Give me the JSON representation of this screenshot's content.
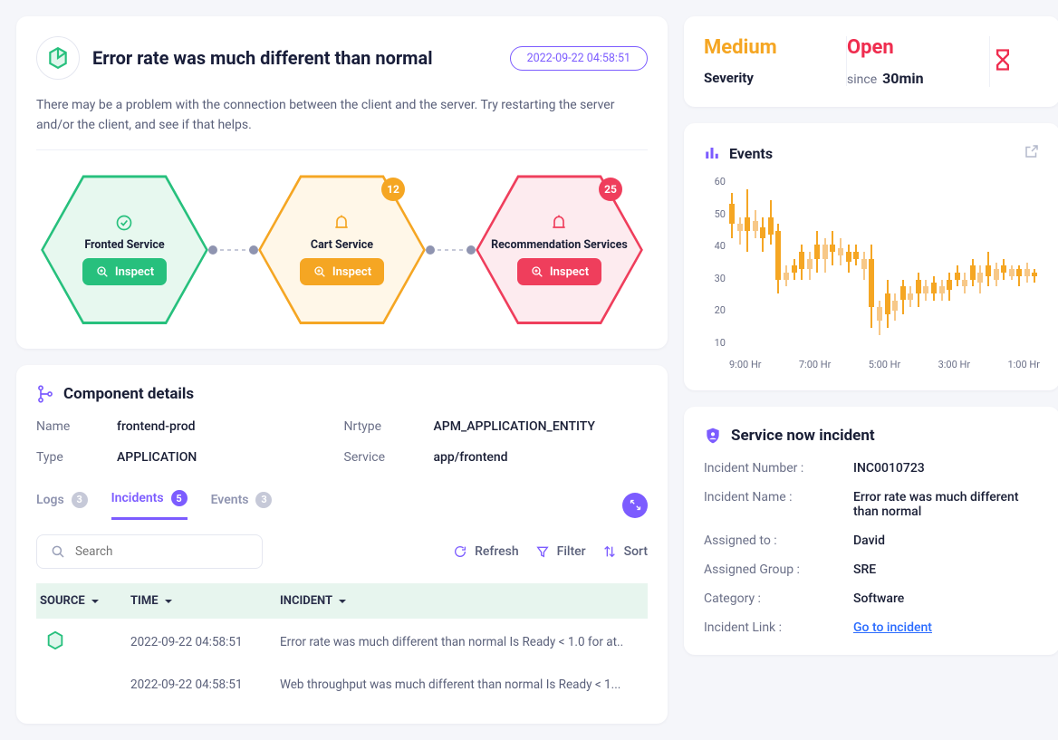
{
  "main": {
    "title": "Error rate was much different than normal",
    "timestamp": "2022-09-22 04:58:51",
    "description": "There may be a problem with the connection between the client and the server. Try restarting the server and/or the client, and see if that helps.",
    "nodes": [
      {
        "name": "Fronted  Service",
        "variant": "green",
        "badge": null,
        "inspect": "Inspect"
      },
      {
        "name": "Cart Service",
        "variant": "orange",
        "badge": "12",
        "inspect": "Inspect"
      },
      {
        "name": "Recommendation Services",
        "variant": "red",
        "badge": "25",
        "inspect": "Inspect"
      }
    ]
  },
  "component": {
    "title": "Component details",
    "fields": {
      "name_label": "Name",
      "name_val": "frontend-prod",
      "nrtype_label": "Nrtype",
      "nrtype_val": "APM_APPLICATION_ENTITY",
      "type_label": "Type",
      "type_val": "APPLICATION",
      "service_label": "Service",
      "service_val": "app/frontend"
    },
    "tabs": [
      {
        "label": "Logs",
        "count": "3",
        "active": false
      },
      {
        "label": "Incidents",
        "count": "5",
        "active": true
      },
      {
        "label": "Events",
        "count": "3",
        "active": false
      }
    ],
    "toolbar": {
      "search_placeholder": "Search",
      "refresh": "Refresh",
      "filter": "Filter",
      "sort": "Sort"
    },
    "table": {
      "headers": {
        "source": "SOURCE",
        "time": "TIME",
        "incident": "INCIDENT"
      },
      "rows": [
        {
          "has_icon": true,
          "time": "2022-09-22 04:58:51",
          "incident": "Error rate was much different than normal Is Ready < 1.0 for at.."
        },
        {
          "has_icon": false,
          "time": "2022-09-22 04:58:51",
          "incident": "Web throughput was much different than normal Is Ready < 1..."
        }
      ]
    }
  },
  "status": {
    "severity_val": "Medium",
    "severity_lbl": "Severity",
    "state_val": "Open",
    "since_lbl": "since",
    "since_val": "30min"
  },
  "events": {
    "title": "Events",
    "y_ticks": [
      "60",
      "50",
      "40",
      "30",
      "20",
      "10"
    ],
    "x_ticks": [
      "9:00 Hr",
      "7:00 Hr",
      "5:00 Hr",
      "3:00 Hr",
      "1:00 Hr"
    ]
  },
  "chart_data": {
    "type": "candlestick",
    "title": "Events",
    "ylim": [
      10,
      60
    ],
    "y_ticks": [
      10,
      20,
      30,
      40,
      50,
      60
    ],
    "x_ticks": [
      "9:00 Hr",
      "7:00 Hr",
      "5:00 Hr",
      "3:00 Hr",
      "1:00 Hr"
    ],
    "series": [
      {
        "x": 0,
        "hi": 55,
        "lo": 42,
        "o": 52,
        "c": 46,
        "color": "#f5a623"
      },
      {
        "x": 2.5,
        "hi": 48,
        "lo": 40,
        "o": 46,
        "c": 44,
        "color": "#f7c888"
      },
      {
        "x": 5,
        "hi": 56,
        "lo": 38,
        "o": 48,
        "c": 44,
        "color": "#f5a623"
      },
      {
        "x": 7.5,
        "hi": 50,
        "lo": 42,
        "o": 47,
        "c": 44,
        "color": "#f7c888"
      },
      {
        "x": 10,
        "hi": 48,
        "lo": 38,
        "o": 45,
        "c": 42,
        "color": "#f5a623"
      },
      {
        "x": 12.5,
        "hi": 53,
        "lo": 40,
        "o": 48,
        "c": 43,
        "color": "#f5a623"
      },
      {
        "x": 15,
        "hi": 46,
        "lo": 26,
        "o": 44,
        "c": 30,
        "color": "#f5a623"
      },
      {
        "x": 17.5,
        "hi": 34,
        "lo": 28,
        "o": 32,
        "c": 30,
        "color": "#f7c888"
      },
      {
        "x": 20,
        "hi": 36,
        "lo": 30,
        "o": 34,
        "c": 32,
        "color": "#f5a623"
      },
      {
        "x": 22.5,
        "hi": 40,
        "lo": 30,
        "o": 38,
        "c": 33,
        "color": "#f5a623"
      },
      {
        "x": 25,
        "hi": 38,
        "lo": 30,
        "o": 36,
        "c": 33,
        "color": "#f7c888"
      },
      {
        "x": 27.5,
        "hi": 44,
        "lo": 32,
        "o": 40,
        "c": 36,
        "color": "#f5a623"
      },
      {
        "x": 30,
        "hi": 42,
        "lo": 32,
        "o": 40,
        "c": 36,
        "color": "#f7c888"
      },
      {
        "x": 32.5,
        "hi": 44,
        "lo": 34,
        "o": 40,
        "c": 38,
        "color": "#f5a623"
      },
      {
        "x": 35,
        "hi": 42,
        "lo": 34,
        "o": 39,
        "c": 37,
        "color": "#f7c888"
      },
      {
        "x": 37.5,
        "hi": 40,
        "lo": 32,
        "o": 38,
        "c": 35,
        "color": "#f5a623"
      },
      {
        "x": 40,
        "hi": 40,
        "lo": 34,
        "o": 38,
        "c": 36,
        "color": "#f5a623"
      },
      {
        "x": 42.5,
        "hi": 38,
        "lo": 30,
        "o": 36,
        "c": 33,
        "color": "#f7c888"
      },
      {
        "x": 45,
        "hi": 40,
        "lo": 16,
        "o": 36,
        "c": 22,
        "color": "#f5a623"
      },
      {
        "x": 47.5,
        "hi": 24,
        "lo": 14,
        "o": 22,
        "c": 18,
        "color": "#f7c888"
      },
      {
        "x": 50,
        "hi": 30,
        "lo": 16,
        "o": 26,
        "c": 20,
        "color": "#f5a623"
      },
      {
        "x": 52.5,
        "hi": 26,
        "lo": 18,
        "o": 24,
        "c": 21,
        "color": "#f7c888"
      },
      {
        "x": 55,
        "hi": 30,
        "lo": 20,
        "o": 28,
        "c": 24,
        "color": "#f5a623"
      },
      {
        "x": 57.5,
        "hi": 28,
        "lo": 22,
        "o": 26,
        "c": 24,
        "color": "#f7c888"
      },
      {
        "x": 60,
        "hi": 32,
        "lo": 22,
        "o": 30,
        "c": 26,
        "color": "#f5a623"
      },
      {
        "x": 62.5,
        "hi": 30,
        "lo": 24,
        "o": 28,
        "c": 26,
        "color": "#f7c888"
      },
      {
        "x": 65,
        "hi": 31,
        "lo": 24,
        "o": 29,
        "c": 26,
        "color": "#f5a623"
      },
      {
        "x": 67.5,
        "hi": 30,
        "lo": 24,
        "o": 28,
        "c": 26,
        "color": "#f7c888"
      },
      {
        "x": 70,
        "hi": 32,
        "lo": 24,
        "o": 30,
        "c": 27,
        "color": "#f5a623"
      },
      {
        "x": 72.5,
        "hi": 34,
        "lo": 28,
        "o": 32,
        "c": 30,
        "color": "#f5a623"
      },
      {
        "x": 75,
        "hi": 32,
        "lo": 26,
        "o": 30,
        "c": 28,
        "color": "#f7c888"
      },
      {
        "x": 77.5,
        "hi": 36,
        "lo": 28,
        "o": 34,
        "c": 30,
        "color": "#f5a623"
      },
      {
        "x": 80,
        "hi": 34,
        "lo": 26,
        "o": 32,
        "c": 29,
        "color": "#f7c888"
      },
      {
        "x": 82.5,
        "hi": 38,
        "lo": 28,
        "o": 34,
        "c": 31,
        "color": "#f5a623"
      },
      {
        "x": 85,
        "hi": 35,
        "lo": 28,
        "o": 33,
        "c": 30,
        "color": "#f7c888"
      },
      {
        "x": 87.5,
        "hi": 36,
        "lo": 30,
        "o": 34,
        "c": 32,
        "color": "#f5a623"
      },
      {
        "x": 90,
        "hi": 34,
        "lo": 30,
        "o": 33,
        "c": 31,
        "color": "#f7c888"
      },
      {
        "x": 92.5,
        "hi": 34,
        "lo": 28,
        "o": 33,
        "c": 31,
        "color": "#f5a623"
      },
      {
        "x": 95,
        "hi": 35,
        "lo": 29,
        "o": 33,
        "c": 31,
        "color": "#f7c888"
      },
      {
        "x": 97.5,
        "hi": 33,
        "lo": 29,
        "o": 32,
        "c": 31,
        "color": "#f5a623"
      }
    ]
  },
  "servicenow": {
    "title": "Service now incident",
    "rows": [
      {
        "l": "Incident Number :",
        "v": "INC0010723"
      },
      {
        "l": "Incident Name :",
        "v": "Error rate was much different than normal"
      },
      {
        "l": "Assigned to :",
        "v": "David"
      },
      {
        "l": "Assigned Group :",
        "v": "SRE"
      },
      {
        "l": "Category :",
        "v": "Software"
      },
      {
        "l": "Incident Link :",
        "v": "Go to incident",
        "link": true
      }
    ]
  }
}
